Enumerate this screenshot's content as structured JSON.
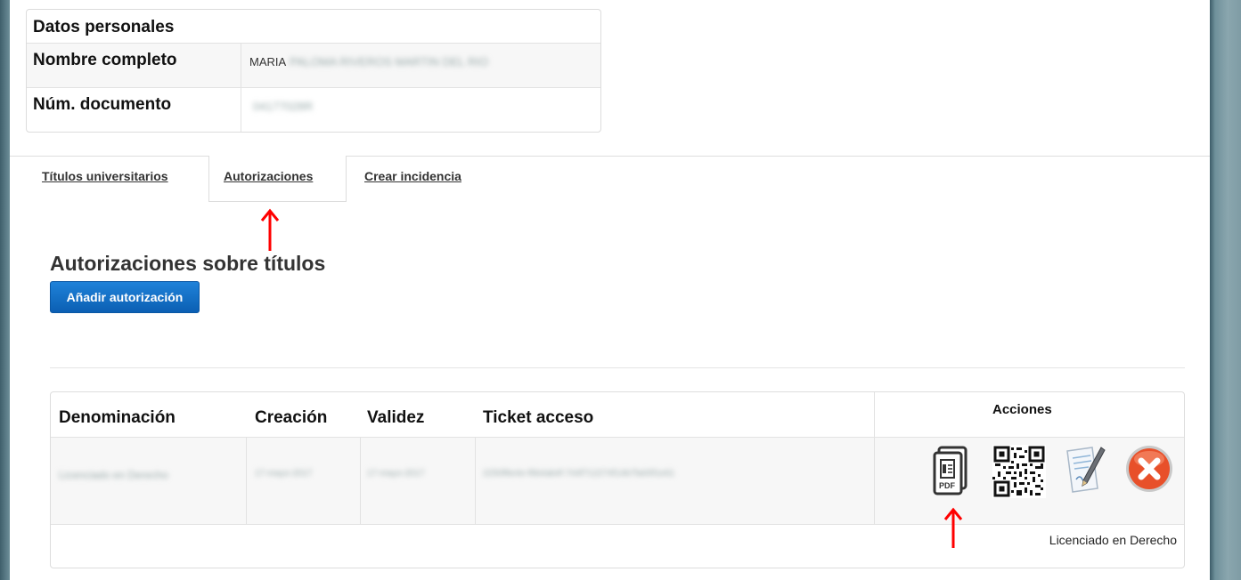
{
  "personal": {
    "title": "Datos personales",
    "name_label": "Nombre completo",
    "name_value": "MARIA",
    "name_value_blurred": "PALOMA RIVEROS MARTIN DEL RIO",
    "doc_label": "Núm. documento",
    "doc_value_blurred": "04177028R"
  },
  "tabs": [
    {
      "label": "Títulos universitarios"
    },
    {
      "label": "Autorizaciones",
      "active": true
    },
    {
      "label": "Crear incidencia"
    }
  ],
  "section": {
    "title": "Autorizaciones sobre títulos",
    "add_button": "Añadir autorización"
  },
  "table": {
    "headers": [
      "Denominación",
      "Creación",
      "Validez",
      "Ticket acceso",
      "Acciones"
    ],
    "row": {
      "denominacion": "Licenciado en Derecho",
      "creacion": "17-mayo-2017",
      "validez": "17-mayo-2017",
      "ticket": "2250f8e4e-f6b4ab4f-744f712274f14b7fa00f1e61"
    },
    "row_caption": "Licenciado en Derecho"
  },
  "icons": {
    "pdf": "pdf-icon",
    "qr": "qr-code-icon",
    "edit": "edit-document-icon",
    "delete": "delete-icon"
  },
  "colors": {
    "primary_button": "#1a73c9",
    "annotation_arrow": "#ff0000",
    "delete": "#e8502a"
  }
}
